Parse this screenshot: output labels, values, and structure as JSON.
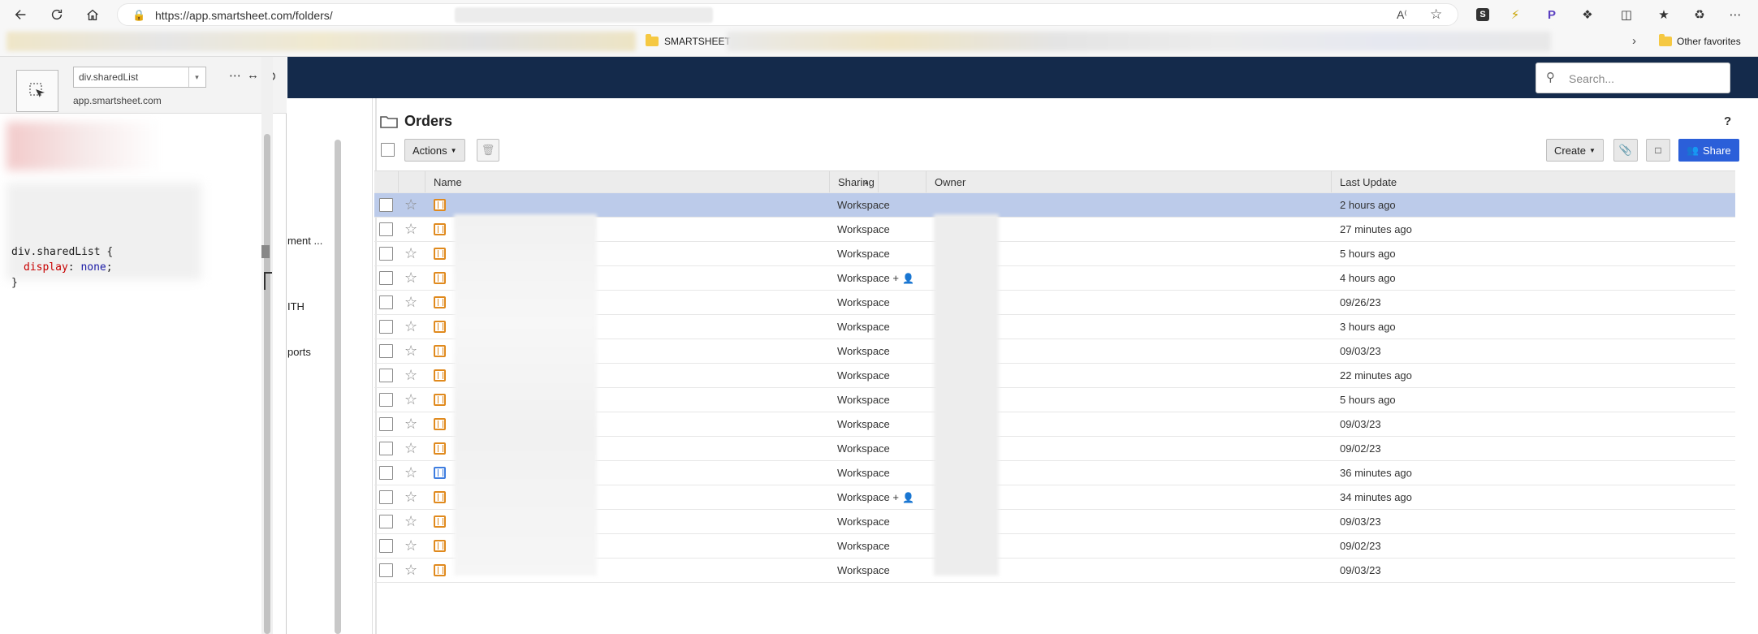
{
  "browser": {
    "url": "https://app.smartsheet.com/folders/",
    "fav_folder": "SMARTSHEET",
    "other_favorites": "Other favorites"
  },
  "devtools": {
    "selector_value": "div.sharedList",
    "host": "app.smartsheet.com",
    "css_selector": "div.sharedList",
    "css_property": "display",
    "css_value": "none",
    "brace_open": "{",
    "brace_close": "}"
  },
  "appnav": {
    "items": [
      {
        "label": "ment ..."
      },
      {
        "label": "ITH"
      },
      {
        "label": "ports"
      }
    ]
  },
  "search": {
    "placeholder": "Search..."
  },
  "page": {
    "title": "Orders",
    "help": "?",
    "actions_label": "Actions",
    "create_label": "Create",
    "share_label": "Share"
  },
  "grid": {
    "headers": {
      "name": "Name",
      "sharing": "Sharing",
      "owner": "Owner",
      "last_update": "Last Update"
    },
    "rows": [
      {
        "type": "sheet",
        "sharing": "Workspace",
        "shared_user": false,
        "last_update": "2 hours ago",
        "selected": true
      },
      {
        "type": "sheet",
        "sharing": "Workspace",
        "shared_user": false,
        "last_update": "27 minutes ago"
      },
      {
        "type": "sheet",
        "sharing": "Workspace",
        "shared_user": false,
        "last_update": "5 hours ago"
      },
      {
        "type": "sheet",
        "sharing": "Workspace +",
        "shared_user": true,
        "last_update": "4 hours ago"
      },
      {
        "type": "sheet",
        "sharing": "Workspace",
        "shared_user": false,
        "last_update": "09/26/23"
      },
      {
        "type": "sheet",
        "sharing": "Workspace",
        "shared_user": false,
        "last_update": "3 hours ago"
      },
      {
        "type": "sheet",
        "sharing": "Workspace",
        "shared_user": false,
        "last_update": "09/03/23"
      },
      {
        "type": "sheet",
        "sharing": "Workspace",
        "shared_user": false,
        "last_update": "22 minutes ago"
      },
      {
        "type": "sheet",
        "sharing": "Workspace",
        "shared_user": false,
        "last_update": "5 hours ago"
      },
      {
        "type": "sheet",
        "sharing": "Workspace",
        "shared_user": false,
        "last_update": "09/03/23"
      },
      {
        "type": "sheet",
        "sharing": "Workspace",
        "shared_user": false,
        "last_update": "09/02/23"
      },
      {
        "type": "document",
        "sharing": "Workspace",
        "shared_user": false,
        "last_update": "36 minutes ago"
      },
      {
        "type": "sheet",
        "sharing": "Workspace +",
        "shared_user": true,
        "last_update": "34 minutes ago"
      },
      {
        "type": "sheet",
        "sharing": "Workspace",
        "shared_user": false,
        "last_update": "09/03/23"
      },
      {
        "type": "sheet",
        "sharing": "Workspace",
        "shared_user": false,
        "last_update": "09/02/23"
      },
      {
        "type": "sheet",
        "sharing": "Workspace",
        "shared_user": false,
        "last_update": "09/03/23"
      }
    ]
  },
  "colors": {
    "appbar": "#142a4b",
    "share": "#2b5fd9",
    "selected_row": "#bccbea",
    "sheet_icon": "#e08a1e"
  }
}
